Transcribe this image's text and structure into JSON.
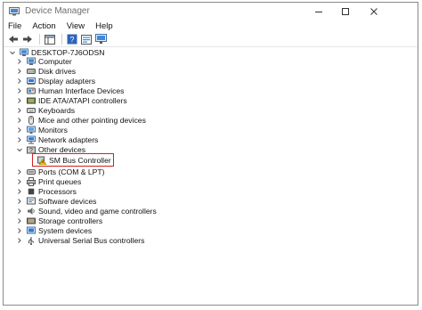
{
  "window": {
    "title": "Device Manager"
  },
  "menu": [
    "File",
    "Action",
    "View",
    "Help"
  ],
  "tree": {
    "root": "DESKTOP-7J6ODSN",
    "categories": [
      {
        "label": "Computer",
        "icon": "computer-icon"
      },
      {
        "label": "Disk drives",
        "icon": "disk-drive-icon"
      },
      {
        "label": "Display adapters",
        "icon": "display-adapter-icon"
      },
      {
        "label": "Human Interface Devices",
        "icon": "hid-icon"
      },
      {
        "label": "IDE ATA/ATAPI controllers",
        "icon": "ide-controller-icon"
      },
      {
        "label": "Keyboards",
        "icon": "keyboard-icon"
      },
      {
        "label": "Mice and other pointing devices",
        "icon": "mouse-icon"
      },
      {
        "label": "Monitors",
        "icon": "monitor-icon"
      },
      {
        "label": "Network adapters",
        "icon": "network-adapter-icon"
      },
      {
        "label": "Other devices",
        "icon": "other-devices-icon",
        "expanded": true,
        "children": [
          {
            "label": "SM Bus Controller",
            "icon": "warning-device-icon",
            "highlighted": true
          }
        ]
      },
      {
        "label": "Ports (COM & LPT)",
        "icon": "port-icon"
      },
      {
        "label": "Print queues",
        "icon": "printer-icon"
      },
      {
        "label": "Processors",
        "icon": "processor-icon"
      },
      {
        "label": "Software devices",
        "icon": "software-device-icon"
      },
      {
        "label": "Sound, video and game controllers",
        "icon": "sound-icon"
      },
      {
        "label": "Storage controllers",
        "icon": "storage-controller-icon"
      },
      {
        "label": "System devices",
        "icon": "system-device-icon"
      },
      {
        "label": "Universal Serial Bus controllers",
        "icon": "usb-icon"
      }
    ]
  },
  "colors": {
    "highlight": "#d32020",
    "accent": "#2e7bcf"
  }
}
